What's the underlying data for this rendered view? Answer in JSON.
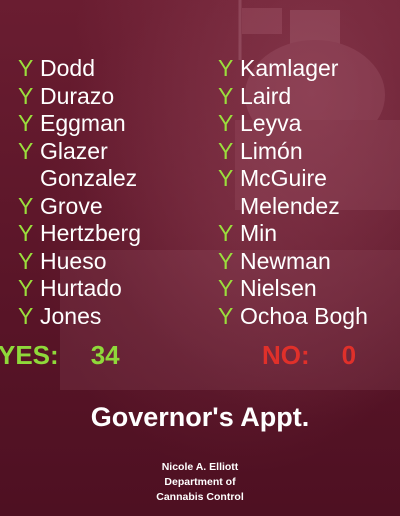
{
  "left_column": [
    {
      "vote": "Y",
      "name": "Dodd"
    },
    {
      "vote": "Y",
      "name": "Durazo"
    },
    {
      "vote": "Y",
      "name": "Eggman"
    },
    {
      "vote": "Y",
      "name": "Glazer"
    },
    {
      "vote": "",
      "name": "Gonzalez"
    },
    {
      "vote": "Y",
      "name": "Grove"
    },
    {
      "vote": "Y",
      "name": "Hertzberg"
    },
    {
      "vote": "Y",
      "name": "Hueso"
    },
    {
      "vote": "Y",
      "name": "Hurtado"
    },
    {
      "vote": "Y",
      "name": "Jones"
    }
  ],
  "right_column": [
    {
      "vote": "Y",
      "name": "Kamlager"
    },
    {
      "vote": "Y",
      "name": "Laird"
    },
    {
      "vote": "Y",
      "name": "Leyva"
    },
    {
      "vote": "Y",
      "name": "Limón"
    },
    {
      "vote": "Y",
      "name": "McGuire"
    },
    {
      "vote": "",
      "name": "Melendez"
    },
    {
      "vote": "Y",
      "name": "Min"
    },
    {
      "vote": "Y",
      "name": "Newman"
    },
    {
      "vote": "Y",
      "name": "Nielsen"
    },
    {
      "vote": "Y",
      "name": "Ochoa Bogh"
    }
  ],
  "tally": {
    "yes_label": "YES:",
    "yes_count": "34",
    "no_label": "NO:",
    "no_count": "0"
  },
  "title": "Governor's Appt.",
  "appointee": {
    "name": "Nicole A. Elliott",
    "dept_line1": "Department of",
    "dept_line2": "Cannabis Control"
  },
  "colors": {
    "background": "#5a1528",
    "yes_vote": "#9adf3c",
    "yes_tally": "#8fd93a",
    "no_tally": "#e0302a",
    "text": "#ffffff"
  }
}
